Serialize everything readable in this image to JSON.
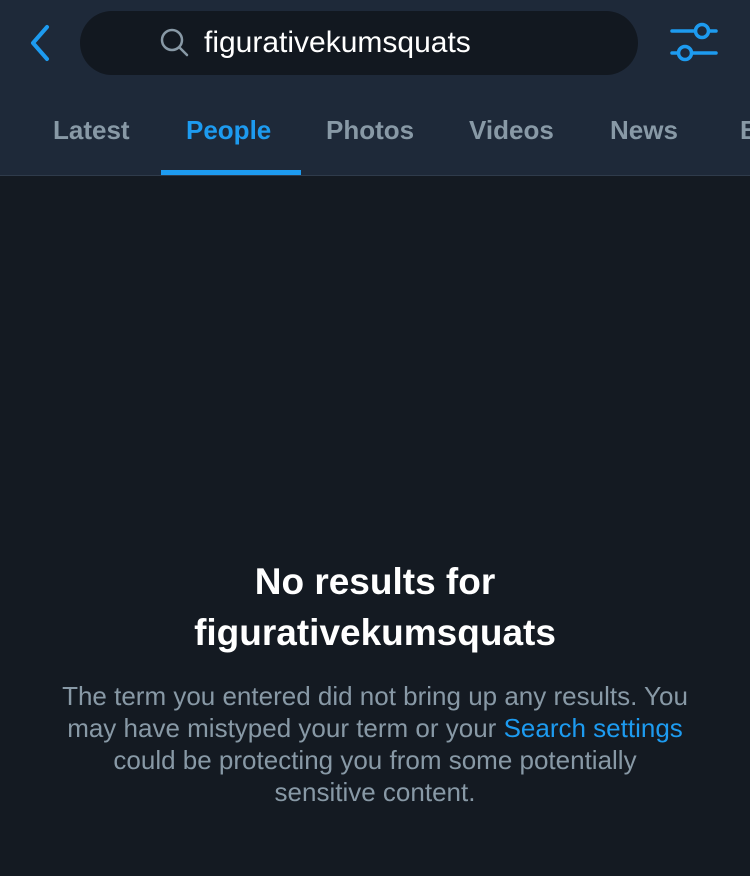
{
  "header": {
    "search_query": "figurativekumsquats",
    "icons": {
      "back": "back-chevron-icon",
      "search": "search-icon",
      "filters": "sliders-icon"
    },
    "accent_color": "#1d9bf0"
  },
  "tabs": [
    {
      "label": "Latest",
      "active": false
    },
    {
      "label": "People",
      "active": true
    },
    {
      "label": "Photos",
      "active": false
    },
    {
      "label": "Videos",
      "active": false
    },
    {
      "label": "News",
      "active": false
    },
    {
      "label": "B",
      "active": false
    }
  ],
  "empty_state": {
    "title_line1": "No results for",
    "title_line2": "figurativekumsquats",
    "desc_before": "The term you entered did not bring up any results. You may have mistyped your term or your ",
    "desc_link": "Search settings",
    "desc_after": " could be protecting you from some potentially sensitive content."
  }
}
